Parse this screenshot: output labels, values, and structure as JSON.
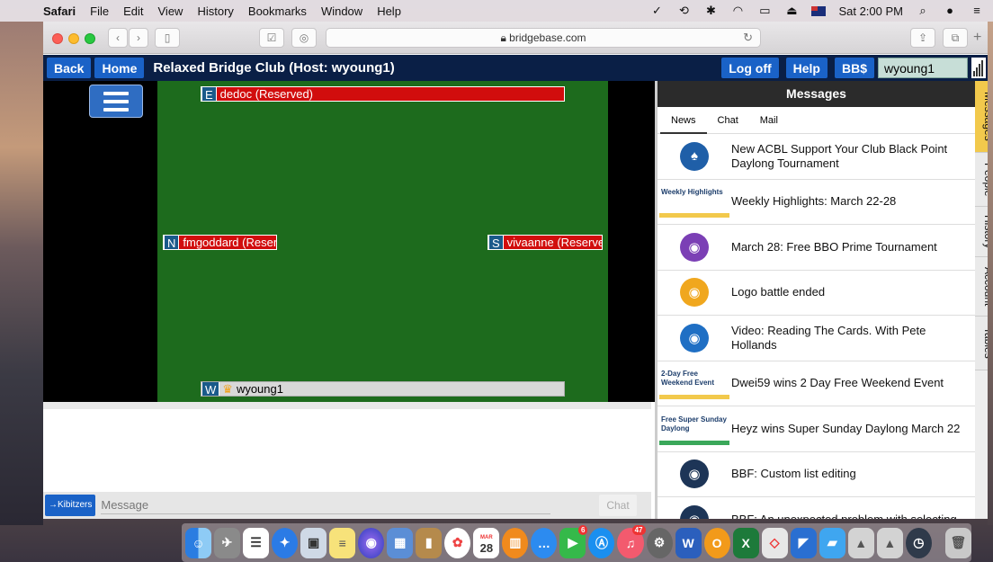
{
  "menubar": {
    "apple": "",
    "app": "Safari",
    "items": [
      "File",
      "Edit",
      "View",
      "History",
      "Bookmarks",
      "Window",
      "Help"
    ],
    "clock": "Sat 2:00 PM"
  },
  "browser": {
    "url": "bridgebase.com"
  },
  "bbo_header": {
    "back": "Back",
    "home": "Home",
    "title": "Relaxed Bridge Club (Host: wyoung1)",
    "logoff": "Log off",
    "help": "Help",
    "bbs": "BB$",
    "username": "wyoung1"
  },
  "table": {
    "seats": [
      {
        "dir": "E",
        "name": "dedoc (Reserved)"
      },
      {
        "dir": "N",
        "name": "fmgoddard (Reserv"
      },
      {
        "dir": "S",
        "name": "vivaanne (Reserved"
      },
      {
        "dir": "W",
        "name": "wyoung1"
      }
    ]
  },
  "chat": {
    "kibitzers": "→Kibitzers",
    "placeholder": "Message",
    "send": "Chat"
  },
  "messages": {
    "title": "Messages",
    "tabs": [
      "News",
      "Chat",
      "Mail"
    ],
    "news": [
      {
        "text": "New ACBL Support Your Club Black Point Daylong Tournament",
        "thumb": "ACBL",
        "color": "#1f5fa8"
      },
      {
        "text": "Weekly Highlights: March 22-28",
        "thumb": "Weekly Highlights",
        "color": "#f2c94c"
      },
      {
        "text": "March 28: Free BBO Prime Tournament",
        "thumb": "",
        "color": "#7b3fb5"
      },
      {
        "text": "Logo battle ended",
        "thumb": "",
        "color": "#f0a71e"
      },
      {
        "text": "Video: Reading The Cards. With Pete Hollands",
        "thumb": "",
        "color": "#1f6fc4"
      },
      {
        "text": "Dwei59 wins 2 Day Free Weekend Event",
        "thumb": "2-Day Free Weekend Event",
        "color": "#f2c94c"
      },
      {
        "text": "Heyz wins Super Sunday Daylong March 22",
        "thumb": "Free Super Sunday Daylong",
        "color": "#3aa85a"
      },
      {
        "text": "BBF: Custom list editing",
        "thumb": "",
        "color": "#1d3557"
      },
      {
        "text": "BBF: An unexpected problem with selecting",
        "thumb": "",
        "color": "#1d3557"
      }
    ]
  },
  "side_tabs": [
    "Messages",
    "People",
    "History",
    "Account",
    "Tables"
  ],
  "dock": {
    "calendar_month": "MAR",
    "calendar_day": "28",
    "badges": {
      "messages": "6",
      "appstore": "47"
    }
  }
}
